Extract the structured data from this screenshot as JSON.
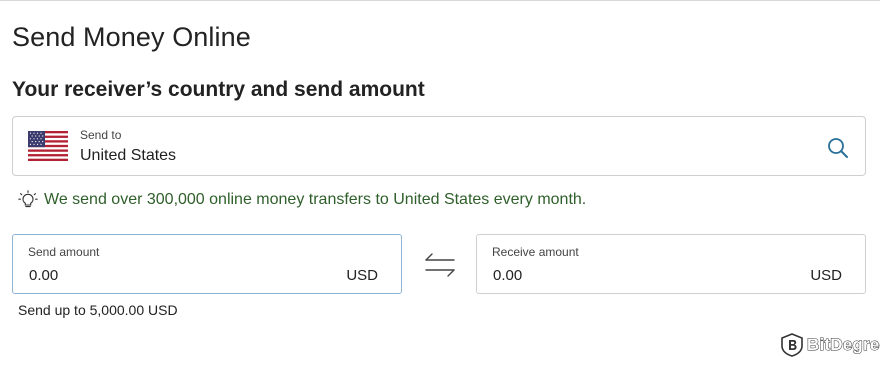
{
  "page": {
    "title": "Send Money Online",
    "section_title": "Your receiver’s country and send amount"
  },
  "country_selector": {
    "label": "Send to",
    "value": "United States",
    "flag_icon": "us-flag-icon",
    "action_icon": "search-icon"
  },
  "info": {
    "icon": "lightbulb-icon",
    "text": "We send over 300,000 online money transfers to United States every month.",
    "color": "#2f5f2a"
  },
  "send_amount": {
    "label": "Send amount",
    "value": "0.00",
    "currency": "USD"
  },
  "swap": {
    "icon": "swap-arrows-icon"
  },
  "receive_amount": {
    "label": "Receive amount",
    "value": "0.00",
    "currency": "USD"
  },
  "limit": {
    "text": "Send up to 5,000.00 USD"
  },
  "watermark": {
    "text": "BitDegree"
  }
}
